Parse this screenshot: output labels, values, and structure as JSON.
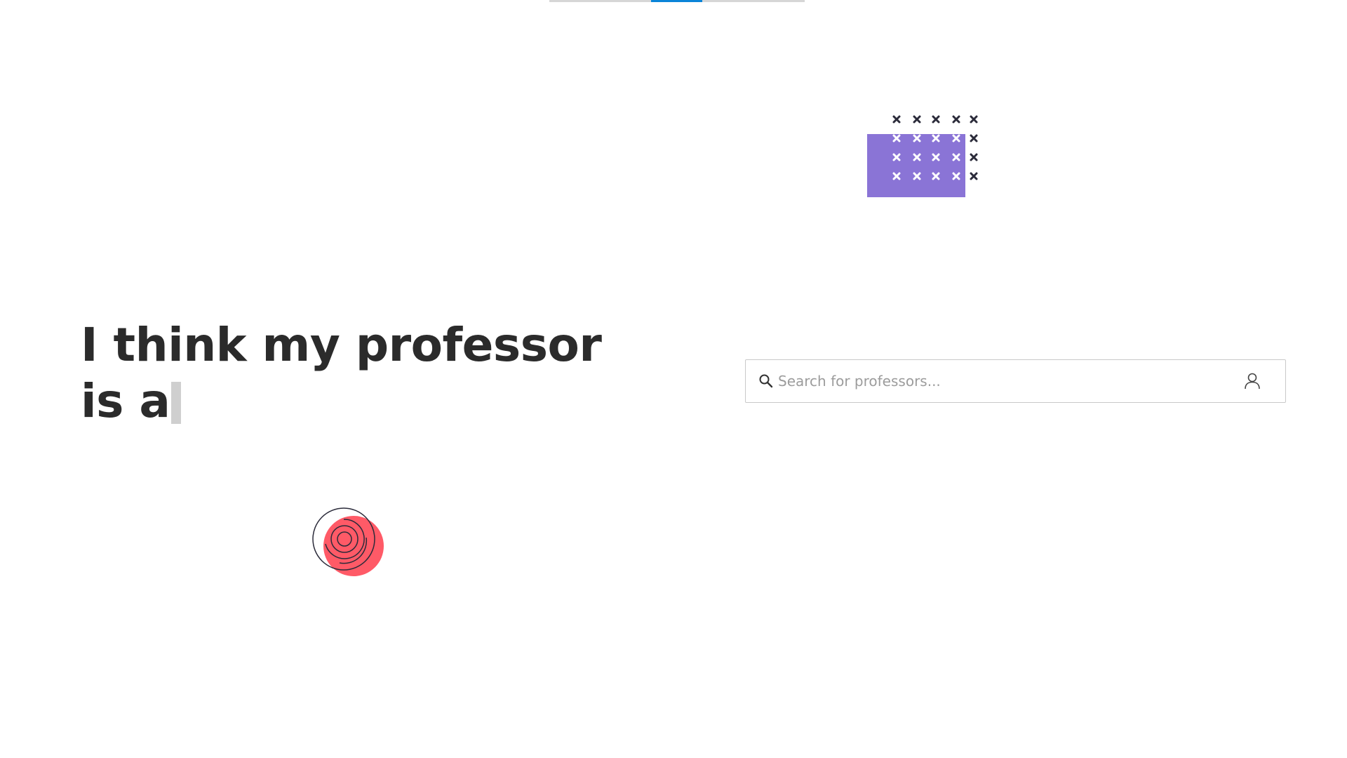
{
  "headline": {
    "line1": "I think my professor",
    "line2": "is a"
  },
  "search": {
    "placeholder": "Search for professors..."
  },
  "icons": {
    "search": "search-icon",
    "user": "user-icon",
    "decor_grid": "x-pattern-grid",
    "decor_circle": "swirl-circle"
  },
  "colors": {
    "accent": "#0a84d8",
    "purple": "#8a74d6",
    "coral": "#ff5a67",
    "text": "#2b2b2b"
  },
  "progress": {
    "indicator_segment": "2 of 5"
  }
}
